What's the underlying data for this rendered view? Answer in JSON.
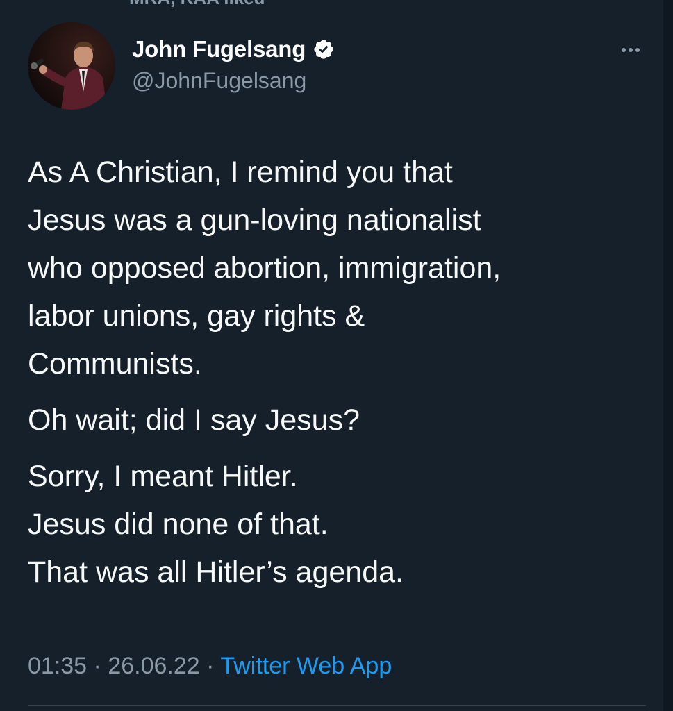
{
  "context": {
    "text": "MRA, RAA liked"
  },
  "author": {
    "display_name": "John Fugelsang",
    "handle": "@JohnFugelsang",
    "verified": true,
    "avatar_icon": "avatar-photo"
  },
  "tweet": {
    "paragraphs": [
      "As A Christian, I remind you that\nJesus was a gun-loving nationalist\nwho opposed abortion, immigration,\nlabor unions, gay rights &\nCommunists.",
      "Oh wait; did I say Jesus?",
      "Sorry, I meant Hitler.\nJesus did none of that.\nThat was all Hitler’s agenda."
    ]
  },
  "meta": {
    "time": "01:35",
    "separator": "·",
    "date": "26.06.22",
    "source": "Twitter Web App"
  },
  "icons": {
    "verified": "verified-badge-icon",
    "more": "more-dots-icon"
  },
  "colors": {
    "background": "#15202b",
    "text": "#f7f9f9",
    "secondary": "#8b98a5",
    "link": "#1d9bf0"
  }
}
